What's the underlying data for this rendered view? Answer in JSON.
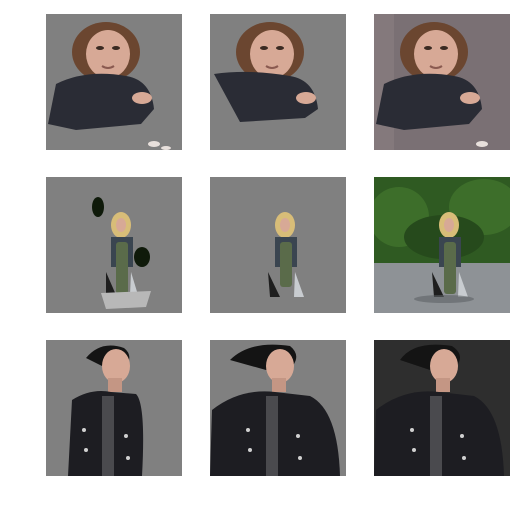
{
  "colors": {
    "page_background": "#ffffff",
    "mask_gray": "#808080",
    "asphalt": "#7a7074",
    "foliage": "#2f5a22",
    "road": "#8e9296",
    "dark_wall": "#2e2e2e",
    "hair_brown": "#6b4630",
    "hair_blonde": "#d8bd78",
    "hair_black": "#141414",
    "skin": "#d7a996",
    "jacket_black": "#1d1d22"
  },
  "grid": {
    "rows": 3,
    "columns": 3,
    "row_subjects": [
      "woman-crouching-overhead",
      "girl-with-skateboard",
      "man-in-studded-jacket"
    ],
    "column_types": [
      "segmentation-mask-a",
      "segmentation-mask-b",
      "original-photo"
    ]
  }
}
